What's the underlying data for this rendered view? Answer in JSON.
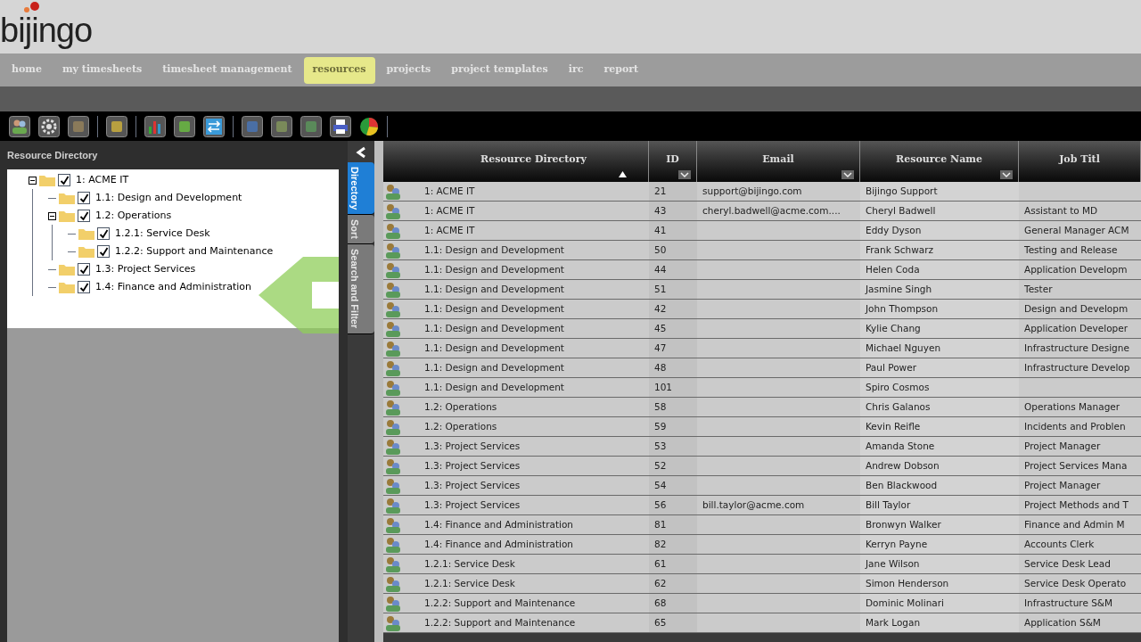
{
  "logo": {
    "text": "bijingo"
  },
  "nav": [
    {
      "label": "home",
      "selected": false
    },
    {
      "label": "my timesheets",
      "selected": false
    },
    {
      "label": "timesheet management",
      "selected": false
    },
    {
      "label": "resources",
      "selected": true
    },
    {
      "label": "projects",
      "selected": false
    },
    {
      "label": "project templates",
      "selected": false
    },
    {
      "label": "irc",
      "selected": false
    },
    {
      "label": "report",
      "selected": false
    }
  ],
  "tree": {
    "title": "Resource Directory",
    "items": [
      {
        "label": "1: ACME IT",
        "checked": true,
        "expanded": true,
        "children": [
          {
            "label": "1.1: Design and Development",
            "checked": true
          },
          {
            "label": "1.2: Operations",
            "checked": true,
            "expanded": true,
            "children": [
              {
                "label": "1.2.1: Service Desk",
                "checked": true
              },
              {
                "label": "1.2.2: Support and Maintenance",
                "checked": true
              }
            ]
          },
          {
            "label": "1.3: Project Services",
            "checked": true
          },
          {
            "label": "1.4: Finance and Administration",
            "checked": true
          }
        ]
      }
    ]
  },
  "side_tabs": [
    {
      "label": "Directory",
      "selected": true
    },
    {
      "label": "Sort",
      "selected": false
    },
    {
      "label": "Search and Filter",
      "selected": false
    }
  ],
  "table": {
    "columns": [
      {
        "label": "Resource Directory",
        "sorted_ascending": true,
        "filter_menu": false
      },
      {
        "label": "ID",
        "sorted_ascending": false,
        "filter_menu": true
      },
      {
        "label": "Email",
        "sorted_ascending": false,
        "filter_menu": true
      },
      {
        "label": "Resource Name",
        "sorted_ascending": false,
        "filter_menu": true
      },
      {
        "label": "Job Titl",
        "sorted_ascending": false,
        "filter_menu": false
      }
    ],
    "rows": [
      [
        "1: ACME IT",
        "21",
        "support@bijingo.com",
        "Bijingo Support",
        ""
      ],
      [
        "1: ACME IT",
        "43",
        "cheryl.badwell@acme.com....",
        "Cheryl Badwell",
        "Assistant to MD"
      ],
      [
        "1: ACME IT",
        "41",
        "",
        "Eddy Dyson",
        "General Manager ACM"
      ],
      [
        "1.1: Design and Development",
        "50",
        "",
        "Frank Schwarz",
        "Testing and Release"
      ],
      [
        "1.1: Design and Development",
        "44",
        "",
        "Helen Coda",
        "Application Developm"
      ],
      [
        "1.1: Design and Development",
        "51",
        "",
        "Jasmine Singh",
        "Tester"
      ],
      [
        "1.1: Design and Development",
        "42",
        "",
        "John Thompson",
        "Design and Developm"
      ],
      [
        "1.1: Design and Development",
        "45",
        "",
        "Kylie Chang",
        "Application Developer"
      ],
      [
        "1.1: Design and Development",
        "47",
        "",
        "Michael Nguyen",
        "Infrastructure Designe"
      ],
      [
        "1.1: Design and Development",
        "48",
        "",
        "Paul Power",
        "Infrastructure Develop"
      ],
      [
        "1.1: Design and Development",
        "101",
        "",
        "Spiro Cosmos",
        ""
      ],
      [
        "1.2: Operations",
        "58",
        "",
        "Chris Galanos",
        "Operations Manager"
      ],
      [
        "1.2: Operations",
        "59",
        "",
        "Kevin Reifle",
        "Incidents and Problen"
      ],
      [
        "1.3: Project Services",
        "53",
        "",
        "Amanda Stone",
        "Project Manager"
      ],
      [
        "1.3: Project Services",
        "52",
        "",
        "Andrew Dobson",
        "Project Services Mana"
      ],
      [
        "1.3: Project Services",
        "54",
        "",
        "Ben Blackwood",
        "Project Manager"
      ],
      [
        "1.3: Project Services",
        "56",
        "bill.taylor@acme.com",
        "Bill Taylor",
        "Project Methods and T"
      ],
      [
        "1.4: Finance and Administration",
        "81",
        "",
        "Bronwyn Walker",
        "Finance and Admin M"
      ],
      [
        "1.4: Finance and Administration",
        "82",
        "",
        "Kerryn Payne",
        "Accounts Clerk"
      ],
      [
        "1.2.1: Service Desk",
        "61",
        "",
        "Jane Wilson",
        "Service Desk Lead"
      ],
      [
        "1.2.1: Service Desk",
        "62",
        "",
        "Simon Henderson",
        "Service Desk Operato"
      ],
      [
        "1.2.2: Support and Maintenance",
        "68",
        "",
        "Dominic Molinari",
        "Infrastructure S&M"
      ],
      [
        "1.2.2: Support and Maintenance",
        "65",
        "",
        "Mark Logan",
        "Application S&M"
      ]
    ]
  }
}
